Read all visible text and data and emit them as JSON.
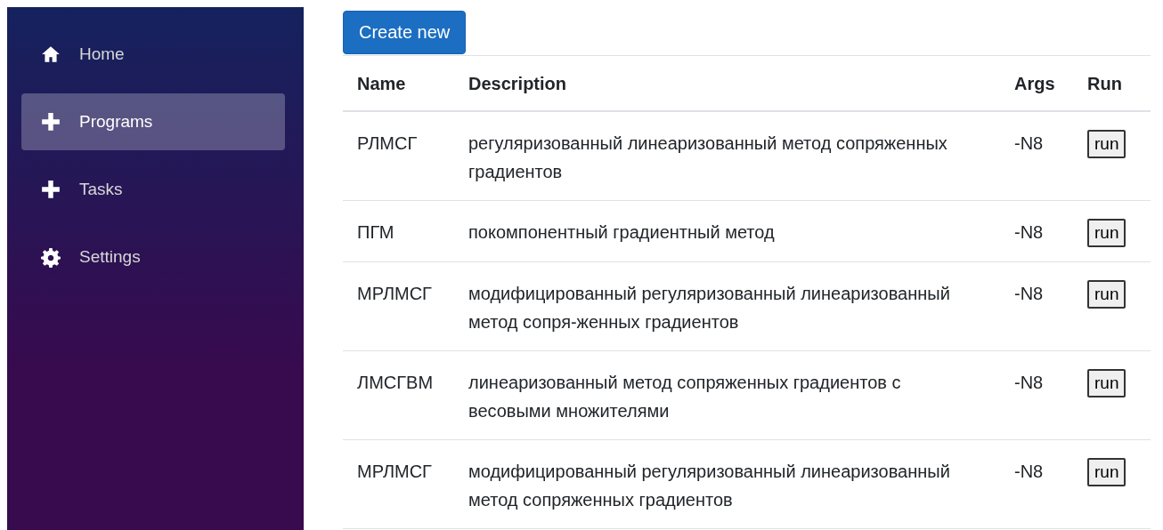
{
  "sidebar": {
    "items": [
      {
        "label": "Home",
        "kind": "home",
        "selected": false
      },
      {
        "label": "Programs",
        "kind": "plus",
        "selected": true
      },
      {
        "label": "Tasks",
        "kind": "plus",
        "selected": false
      },
      {
        "label": "Settings",
        "kind": "gear",
        "selected": false
      }
    ]
  },
  "create_button": "Create new",
  "table": {
    "columns": [
      "Name",
      "Description",
      "Args",
      "Run"
    ],
    "rows": [
      {
        "name": "РЛМСГ",
        "description": "регуляризованный линеаризованный метод сопряженных градиентов",
        "args": "-N8",
        "action": "run"
      },
      {
        "name": "ПГМ",
        "description": "покомпонентный градиентный метод",
        "args": "-N8",
        "action": "run"
      },
      {
        "name": "МРЛМСГ",
        "description": "модифицированный регуляризованный линеаризованный метод сопря-женных градиентов",
        "args": "-N8",
        "action": "run"
      },
      {
        "name": "ЛМСГВМ",
        "description": "линеаризованный метод сопряженных градиентов с весовыми множителями",
        "args": "-N8",
        "action": "run"
      },
      {
        "name": "МРЛМСГ",
        "description": "модифицированный регуляризованный линеаризованный метод сопряженных градиентов",
        "args": "-N8",
        "action": "run"
      }
    ]
  }
}
